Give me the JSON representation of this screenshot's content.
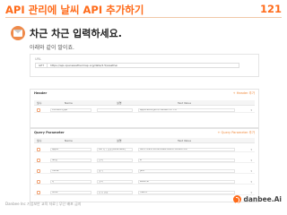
{
  "slide": {
    "title": "API 관리에 날씨 API 추가하기",
    "page_number": "121",
    "heading": "차근 차근 입력하세요.",
    "subtext": "아래와 같이 말이죠.",
    "footer": "Danbee Inc 기업보안 교육 자료 | 무단 배포 금지",
    "logo_text": "danbee.Ai"
  },
  "url_panel": {
    "label": "URL",
    "method": "GET",
    "url": "https://api.openweathermap.org/data/2.5/weather"
  },
  "header_section": {
    "title": "Header",
    "link": "+ Header 추가",
    "columns": [
      "필수",
      "Name",
      "설명",
      "Test Value"
    ],
    "rows": [
      {
        "name": "Content-Type",
        "desc": "",
        "value": "application/json;charset=UTF-8"
      }
    ]
  },
  "query_section": {
    "title": "Query Parameter",
    "link": "+ Query Parameter 추가",
    "columns": [
      "필수",
      "Name",
      "설명",
      "Test Value"
    ],
    "rows": [
      {
        "name": "appid",
        "desc": "API 키 / 필요(Parameter)",
        "value": "8637c1a478059dcee451a1dc38d487d9f"
      },
      {
        "name": "lang",
        "desc": "언어",
        "value": "kr"
      },
      {
        "name": "mode",
        "desc": "형식",
        "value": "json"
      },
      {
        "name": "q",
        "desc": "도시",
        "value": "seoul,kr"
      },
      {
        "name": "units",
        "desc": "단위 설정",
        "value": "metric"
      }
    ]
  },
  "colors": {
    "accent": "#ff6b1a",
    "link": "#f08a3c"
  },
  "icons": {
    "avatar": "envelope-icon",
    "dropdown": "chevron-down-icon",
    "logo": "danbee-logo-icon"
  }
}
